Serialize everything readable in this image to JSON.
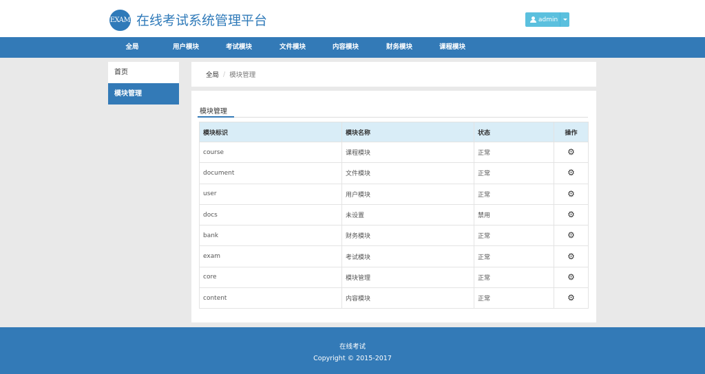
{
  "header": {
    "logo_text": "EXAM",
    "title": "在线考试系统管理平台",
    "user_label": "admin"
  },
  "nav": {
    "items": [
      "全局",
      "用户模块",
      "考试模块",
      "文件模块",
      "内容模块",
      "财务模块",
      "课程模块"
    ]
  },
  "sidebar": {
    "items": [
      {
        "label": "首页",
        "active": false
      },
      {
        "label": "模块管理",
        "active": true
      }
    ]
  },
  "breadcrumb": {
    "home": "全局",
    "separator": "/",
    "current": "模块管理"
  },
  "panel": {
    "tab_label": "模块管理",
    "table": {
      "headers": [
        "模块标识",
        "模块名称",
        "状态",
        "操作"
      ],
      "rows": [
        [
          "course",
          "课程模块",
          "正常"
        ],
        [
          "document",
          "文件模块",
          "正常"
        ],
        [
          "user",
          "用户模块",
          "正常"
        ],
        [
          "docs",
          "未设置",
          "禁用"
        ],
        [
          "bank",
          "财务模块",
          "正常"
        ],
        [
          "exam",
          "考试模块",
          "正常"
        ],
        [
          "core",
          "模块管理",
          "正常"
        ],
        [
          "content",
          "内容模块",
          "正常"
        ]
      ],
      "action_icon": "gear-icon"
    }
  },
  "footer": {
    "line1": "在线考试",
    "line2": "Copyright © 2015-2017"
  },
  "colors": {
    "primary": "#337ab7",
    "info_button": "#5bc0de",
    "table_header_bg": "#d9edf7",
    "page_bg": "#e9e9e9"
  }
}
